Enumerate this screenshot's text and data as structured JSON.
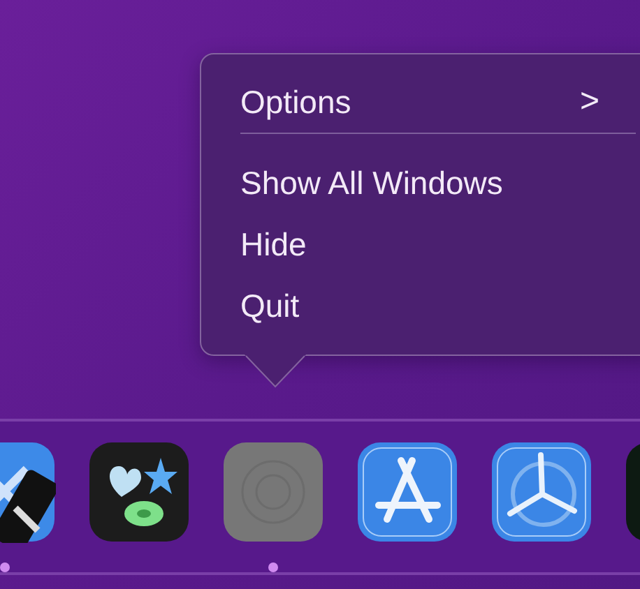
{
  "context_menu": {
    "items": [
      {
        "kind": "submenu",
        "label": "Options",
        "arrow": ">"
      },
      {
        "kind": "separator"
      },
      {
        "kind": "item",
        "label": "Show All Windows"
      },
      {
        "kind": "item",
        "label": "Hide"
      },
      {
        "kind": "item",
        "label": "Quit"
      }
    ]
  },
  "dock": {
    "apps": [
      {
        "kind": "tools-tile",
        "running": true
      },
      {
        "kind": "shapes-tile",
        "running": false
      },
      {
        "kind": "blank-tile",
        "running": true
      },
      {
        "kind": "letter-tile",
        "running": false
      },
      {
        "kind": "propeller-tile",
        "running": false
      },
      {
        "kind": "dark-tile",
        "running": false
      }
    ]
  }
}
